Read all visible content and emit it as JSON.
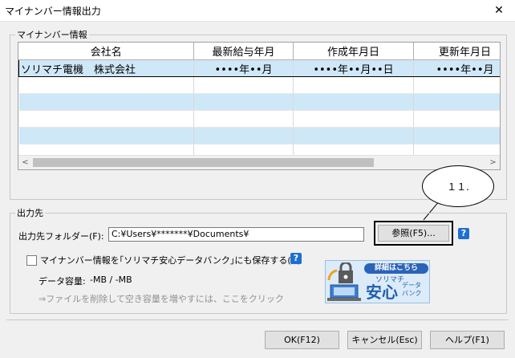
{
  "window": {
    "title": "マイナンバー情報出力",
    "close_glyph": "✕"
  },
  "info_group": {
    "legend": "マイナンバー情報",
    "columns": [
      "会社名",
      "最新給与年月",
      "作成年月日",
      "更新年月日"
    ],
    "rows": [
      {
        "company": "ソリマチ電機　株式会社",
        "latest_salary": "••••年••月",
        "created": "••••年••月••日",
        "updated": "••••年••月"
      }
    ],
    "scroll_left": "<",
    "scroll_right": ">"
  },
  "callout": {
    "text": "１１."
  },
  "output_group": {
    "legend": "出力先",
    "folder_label": "出力先フォルダー(F):",
    "folder_value": "C:¥Users¥*******¥Documents¥",
    "browse_label": "参照(F5)...",
    "help_glyph": "?",
    "save_checkbox_label": "マイナンバー情報を｢ソリマチ安心データバンク｣にも保存する(U)",
    "capacity_label": "データ容量:",
    "capacity_value": "-MB / -MB",
    "delete_link": "⇒ファイルを削除して空き容量を増やすには、ここをクリック",
    "banner": {
      "pill": "詳細はこちら",
      "sub": "ソリマチ",
      "big": "安心",
      "small1": "データ",
      "small2": "バンク"
    }
  },
  "footer": {
    "ok_label": "OK(F12)",
    "cancel_label": "キャンセル(Esc)",
    "help_label": "ヘルプ(F1)"
  }
}
